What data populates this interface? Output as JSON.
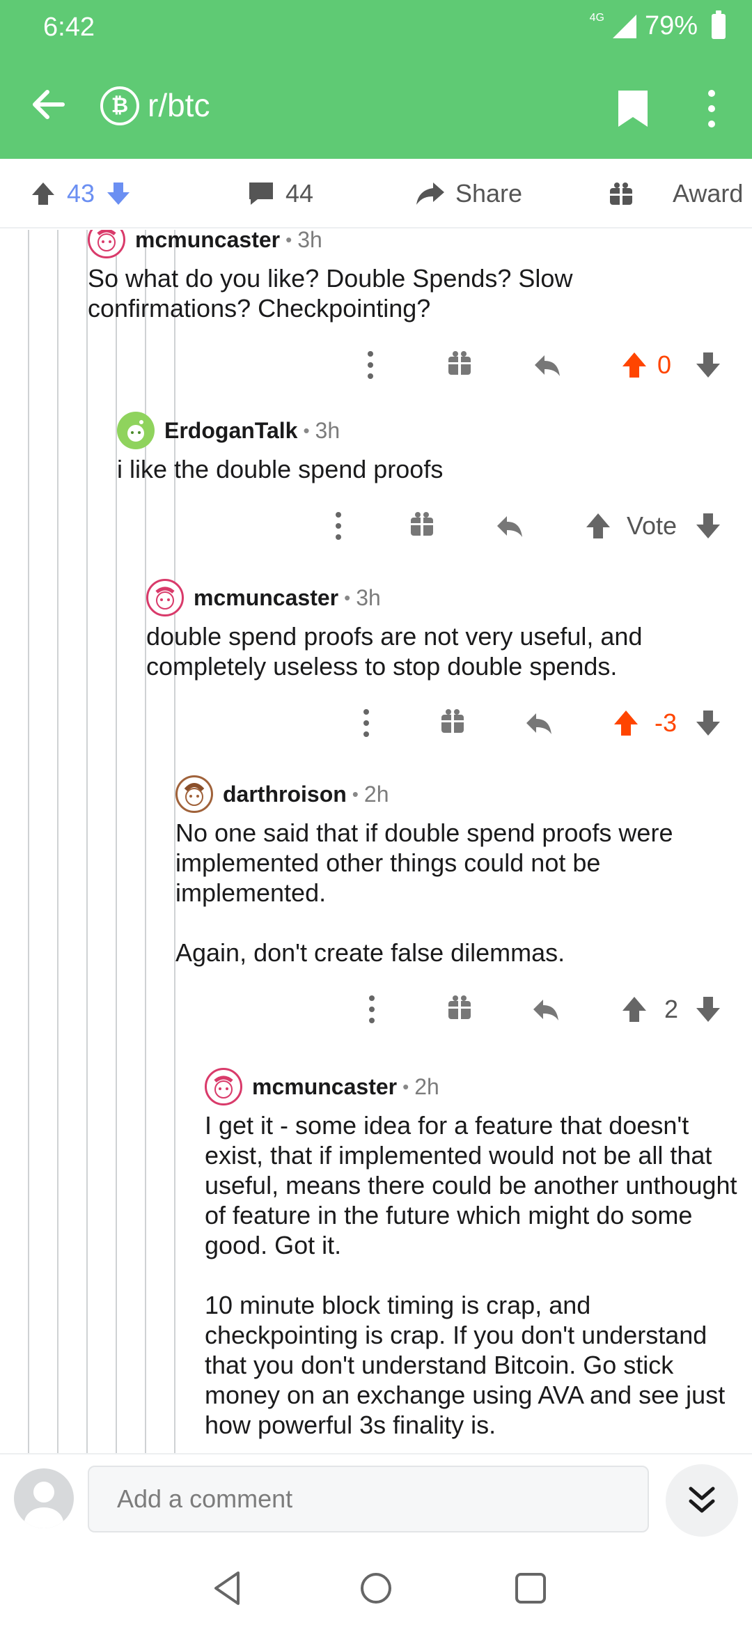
{
  "status": {
    "time": "6:42",
    "network": "4G",
    "battery": "79%"
  },
  "header": {
    "subreddit": "r/btc",
    "subreddit_icon": "bitcoin-cash-icon"
  },
  "post_actions": {
    "score": "43",
    "comments": "44",
    "share_label": "Share",
    "award_label": "Award"
  },
  "comments": [
    {
      "author": "mcmuncaster",
      "time": "3h",
      "body": "So what do you like? Double Spends? Slow confirmations? Checkpointing?",
      "vote": "0",
      "upvoted": true
    },
    {
      "author": "ErdoganTalk",
      "time": "3h",
      "body": "i like the double spend proofs",
      "vote": "Vote",
      "upvoted": false
    },
    {
      "author": "mcmuncaster",
      "time": "3h",
      "body": "double spend proofs are not very useful, and completely useless to stop double spends.",
      "vote": "-3",
      "upvoted": true
    },
    {
      "author": "darthroison",
      "time": "2h",
      "body": "No one said that if double spend proofs were implemented other things could not be implemented.\n\nAgain, don't create false dilemmas.",
      "vote": "2",
      "upvoted": false
    },
    {
      "author": "mcmuncaster",
      "time": "2h",
      "body": "I get it - some idea for a feature that doesn't exist, that if implemented would not be all that useful, means there could be another unthought of feature in the future which might do some good. Got it.\n\n10 minute block timing is crap, and checkpointing is crap. If you don't understand that you don't understand Bitcoin. Go stick money on an exchange using AVA and see just how powerful 3s finality is.",
      "vote": "",
      "upvoted": false
    }
  ],
  "composer": {
    "placeholder": "Add a comment"
  },
  "colors": {
    "header_green": "#5fca74",
    "upvote": "#ff4500",
    "score_blue": "#6b8ff2"
  }
}
